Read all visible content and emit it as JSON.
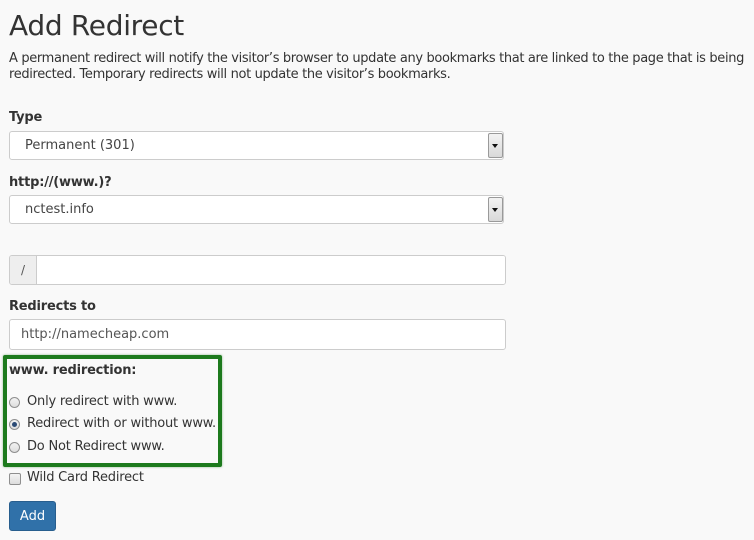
{
  "page": {
    "title": "Add Redirect",
    "description": "A permanent redirect will notify the visitor’s browser to update any bookmarks that are linked to the page that is being redirected. Temporary redirects will not update the visitor’s bookmarks."
  },
  "form": {
    "type": {
      "label": "Type",
      "selected": "Permanent (301)"
    },
    "domain": {
      "label": "http://(www.)?",
      "selected": "nctest.info"
    },
    "path": {
      "prefix": "/",
      "value": ""
    },
    "redirects_to": {
      "label": "Redirects to",
      "value": "http://namecheap.com"
    },
    "www_redirection": {
      "label": "www. redirection:",
      "options": [
        {
          "label": "Only redirect with www.",
          "checked": false
        },
        {
          "label": "Redirect with or without www.",
          "checked": true
        },
        {
          "label": "Do Not Redirect www.",
          "checked": false
        }
      ]
    },
    "wildcard": {
      "label": "Wild Card Redirect",
      "checked": false
    },
    "submit_label": "Add"
  },
  "colors": {
    "background": "#f9f9f9",
    "primary_button": "#3071a9",
    "highlight": "#1d7a1d"
  }
}
